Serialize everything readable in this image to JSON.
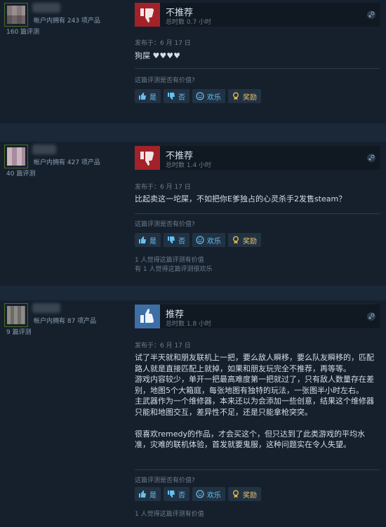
{
  "common": {
    "helpful_question": "这篇评测是否有价值?",
    "btn_yes": "是",
    "btn_no": "否",
    "btn_funny": "欢乐",
    "btn_award": "奖励"
  },
  "reviews": [
    {
      "owned": "帐户内拥有 243 项产品",
      "review_count": "160 篇评测",
      "verdict": "不推荐",
      "hours": "总时数 0.7 小时",
      "posted": "发布于：6 月 17 日",
      "content": [
        "狗屎 ♥♥♥♥"
      ],
      "helpful_stats": []
    },
    {
      "owned": "帐户内拥有 427 项产品",
      "review_count": "40 篇评测",
      "verdict": "不推荐",
      "hours": "总时数 1.4 小时",
      "posted": "发布于：6 月 17 日",
      "content": [
        "比起卖这一坨屎，不如把你E爹独占的心灵杀手2发售steam？"
      ],
      "helpful_stats": [
        "1 人觉得这篇评测有价值",
        "有 1 人觉得这篇评测很欢乐"
      ]
    },
    {
      "owned": "帐户内拥有 87 项产品",
      "review_count": "9 篇评测",
      "verdict": "推荐",
      "hours": "总时数 1.8 小时",
      "posted": "发布于：6 月 17 日",
      "content": [
        "试了半天就和朋友联机上一把，要么敌人瞬移，要么队友瞬移的，匹配路人就是直接匹配上就掉，如果和朋友玩完全不推荐，再等等。",
        "游戏内容较少，单开一把最高难度第一把就过了，只有敌人数量存在差别，地图5个大箱庭，每张地图有独特的玩法，一张图半小时左右。",
        "主武器作为一个维修器，本来还以为会添加一些创意，结果这个维修器只能和地图交互，差异性不足，还是只能拿枪突突。",
        "",
        "很喜欢remedy的作品，才会买这个，但只达到了此类游戏的平均水准，灾难的联机体验，首发就要鬼服，这种问题实在令人失望。"
      ],
      "helpful_stats": [
        "1 人觉得这篇评测有价值"
      ]
    }
  ],
  "colors": {
    "not_recommended": "#a3222a",
    "recommended": "#3d6fa5",
    "link": "#67c1f5"
  }
}
